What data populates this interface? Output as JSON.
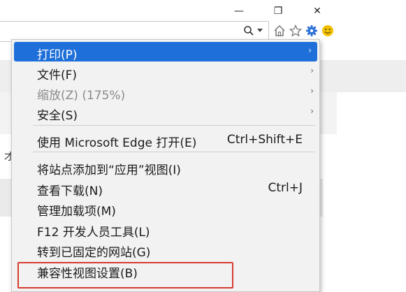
{
  "window": {
    "minimize_glyph": "—",
    "restore_glyph": "❐",
    "close_glyph": "✕"
  },
  "toolbar": {
    "icons": [
      "search-icon",
      "dropdown-arrow-icon",
      "home-icon",
      "favorites-star-icon",
      "settings-gear-icon",
      "smiley-feedback-icon"
    ]
  },
  "background": {
    "left_char": "才"
  },
  "menu": {
    "items": [
      {
        "label": "打印(P)",
        "shortcut": "",
        "submenu": true,
        "highlighted": true
      },
      {
        "label": "文件(F)",
        "shortcut": "",
        "submenu": true
      },
      {
        "label": "缩放(Z) (175%)",
        "shortcut": "",
        "submenu": true,
        "disabled": true
      },
      {
        "label": "安全(S)",
        "shortcut": "",
        "submenu": true
      },
      {
        "label": "使用 Microsoft Edge 打开(E)",
        "shortcut": "Ctrl+Shift+E"
      },
      {
        "label": "将站点添加到“应用”视图(I)",
        "shortcut": ""
      },
      {
        "label": "查看下载(N)",
        "shortcut": "Ctrl+J"
      },
      {
        "label": "管理加载项(M)",
        "shortcut": ""
      },
      {
        "label": "F12 开发人员工具(L)",
        "shortcut": ""
      },
      {
        "label": "转到已固定的网站(G)",
        "shortcut": ""
      },
      {
        "label": "兼容性视图设置(B)",
        "shortcut": "",
        "annotated": true
      }
    ],
    "arrow_glyph": "›"
  },
  "colors": {
    "highlight": "#1e6fd9",
    "annotation_box": "#d63a2f",
    "gear_icon": "#2a6fd6",
    "smiley_icon": "#f2c200"
  }
}
